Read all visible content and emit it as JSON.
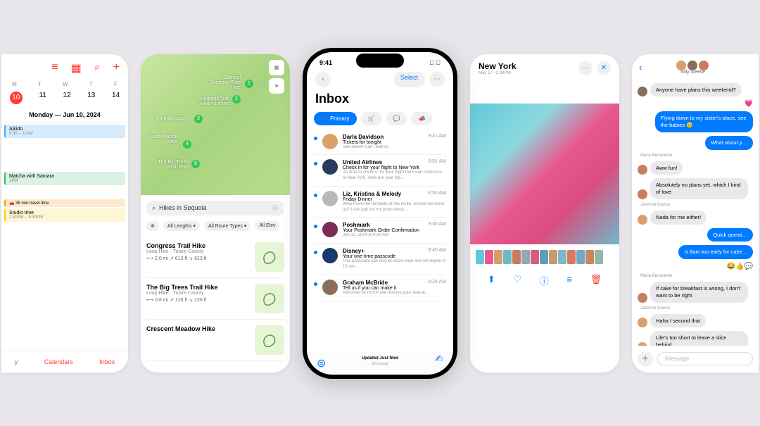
{
  "calendar": {
    "days": [
      "M",
      "T",
      "W",
      "T",
      "F"
    ],
    "nums": [
      "10",
      "11",
      "12",
      "13",
      "14"
    ],
    "header": "Monday — Jun 10, 2024",
    "events": {
      "aikido": {
        "title": "Aikido",
        "time": "9:30 – 11AM"
      },
      "matcha": {
        "title": "Matcha with Samara",
        "time": "1PM"
      },
      "travel": {
        "title": "35 min travel time"
      },
      "studio": {
        "title": "Studio time",
        "time": "2:30PM – 5:30PM"
      }
    },
    "footer": {
      "today": "y",
      "calendars": "Calendars",
      "inbox": "Inbox"
    }
  },
  "maps": {
    "labels": {
      "sherman": "General Sherman Tree Hike",
      "congress": "Congress Trail Hike +1 more",
      "rimrock": "Rimrock Loop",
      "sunset": "Sunset Rock Hike",
      "bigtrees": "The Big Trees Trail Hike"
    },
    "search": "Hikes in Sequoia",
    "filters": {
      "curated": "⊕",
      "lengths": "All Lengths ▾",
      "routes": "All Route Types ▾",
      "elev": "All Elev"
    },
    "hikes": [
      {
        "name": "Congress Trail Hike",
        "sub": "Loop Hike · Tulare County",
        "stats": "⟷ 2.0 mi   ↗ 613 ft   ↘ 613 ft"
      },
      {
        "name": "The Big Trees Trail Hike",
        "sub": "Loop Hike · Tulare County",
        "stats": "⟷ 0.8 mi   ↗ 126 ft   ↘ 126 ft"
      },
      {
        "name": "Crescent Meadow Hike",
        "sub": "",
        "stats": ""
      }
    ]
  },
  "mail": {
    "time": "9:41",
    "select": "Select",
    "title": "Inbox",
    "primary": "Primary",
    "items": [
      {
        "from": "Darla Davidson",
        "time": "9:41 AM",
        "subj": "Tickets for tonight",
        "prev": "See below! Can't wait xx",
        "color": "#d9a06b"
      },
      {
        "from": "United Airlines",
        "time": "8:51 AM",
        "subj": "Check in for your flight to New York",
        "prev": "It's time to check in for your flight from San Francisco to New York. Here are your trip…",
        "color": "#2b3a5c"
      },
      {
        "from": "Liz, Kristina & Melody",
        "time": "8:50 AM",
        "subj": "Friday Dinner",
        "prev": "Wow I love the formality of this invite. Should we dress up? I can pull out my prom dress…",
        "color": "#b8b8b8"
      },
      {
        "from": "Poshmark",
        "time": "9:30 AM",
        "subj": "Your Poshmark Order Confirmation",
        "prev": "Jun 10, 2024 at 9:30 AM",
        "color": "#7b2d56"
      },
      {
        "from": "Disney+",
        "time": "8:40 AM",
        "subj": "Your one-time passcode",
        "prev": "This passcode can only be used once and will expire in 15 min.",
        "color": "#1a3a6e"
      },
      {
        "from": "Graham McBride",
        "time": "8:25 AM",
        "subj": "Tell us if you can make it",
        "prev": "Reminder to RSVP and reserve your seat at…",
        "color": "#8a6d5b"
      }
    ],
    "updated": "Updated Just Now",
    "unread": "12 Unread"
  },
  "photos": {
    "title": "New York",
    "sub": "May 17 · 2:34PM",
    "thumb_colors": [
      "#5fc9d8",
      "#e85a8f",
      "#d4a06b",
      "#6fb8c8",
      "#c87d5f",
      "#8fa8b8",
      "#d85a7f",
      "#5f9db8",
      "#c89a6d",
      "#7fb8c8",
      "#d87a5f",
      "#6fa8c8",
      "#c8855f",
      "#8fb8a8"
    ]
  },
  "messages": {
    "group": "Silly Geese",
    "bubbles": {
      "b1": "Anyone have plans this weekend?",
      "b2": "Flying down to my sister's place, see the babies 😊",
      "b3": "What about y…",
      "s1": "Maria Benavente",
      "b4": "Aww fun!",
      "b5": "Absolutely no plans yet, which I kind of love",
      "s2": "Jasmine Garcia",
      "b6": "Nada for me either!",
      "b7": "Quick questi…",
      "b8": "Is 8am too early for cake…",
      "s3": "Maria Benavente",
      "b9": "If cake for breakfast is wrong, I don't want to be right",
      "s4": "Jasmine Garcia",
      "b10": "Haha I second that",
      "b11": "Life's too short to leave a slice behind"
    },
    "placeholder": "iMessage"
  }
}
